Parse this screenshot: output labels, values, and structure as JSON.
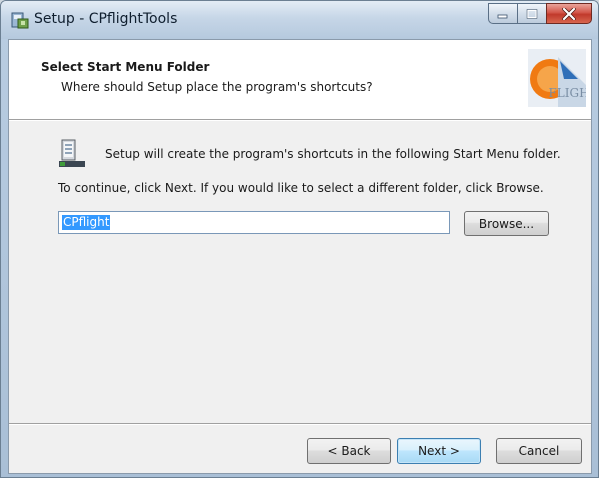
{
  "window": {
    "title": "Setup - CPflightTools",
    "icon": "installer-icon"
  },
  "caption_buttons": {
    "minimize": "minimize-icon",
    "maximize": "maximize-icon",
    "close": "close-icon"
  },
  "header": {
    "title": "Select Start Menu Folder",
    "subtitle": "Where should Setup place the program's shortcuts?",
    "logo_icon": "cpflight-logo-icon",
    "logo_text": "FLIGHT"
  },
  "body": {
    "info_icon": "start-menu-folder-icon",
    "info_text": "Setup will create the program's shortcuts in the following Start Menu folder.",
    "continue_text": "To continue, click Next. If you would like to select a different folder, click Browse.",
    "folder_value": "CPflight",
    "browse_label": "Browse..."
  },
  "footer": {
    "back_label": "< Back",
    "next_label": "Next >",
    "cancel_label": "Cancel"
  },
  "colors": {
    "selection": "#3399ff",
    "close_button": "#c0392b",
    "default_button_border": "#3c7fb1"
  }
}
